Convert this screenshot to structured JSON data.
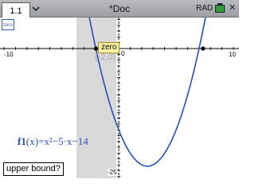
{
  "tab": {
    "label": "1.1"
  },
  "document": {
    "title": "*Doc"
  },
  "status": {
    "angle_mode": "RAD"
  },
  "icons": {
    "zoom": "zoom-icon",
    "close": "close-icon",
    "battery": "battery-icon",
    "chevron": "chevron-down-icon"
  },
  "zoom_icon_text": "zero",
  "axes": {
    "x_min_label": "-10",
    "x_max_label": "10",
    "y_min_label": "-25",
    "zero_label": "0"
  },
  "tooltip": {
    "text": "zero"
  },
  "coordinates": "(-2,0)",
  "function": {
    "name": "f1",
    "variable": "x",
    "definition": "=x²−5·x−14",
    "expression": "x^2 - 5*x - 14",
    "roots": [
      -2,
      7
    ],
    "vertex": [
      2.5,
      -20.25
    ]
  },
  "prompt": {
    "text": "upper bound?"
  },
  "colors": {
    "function": "#2a4fb4",
    "shade": "#d9d9d9",
    "tooltip_bg": "#fff5a8"
  }
}
